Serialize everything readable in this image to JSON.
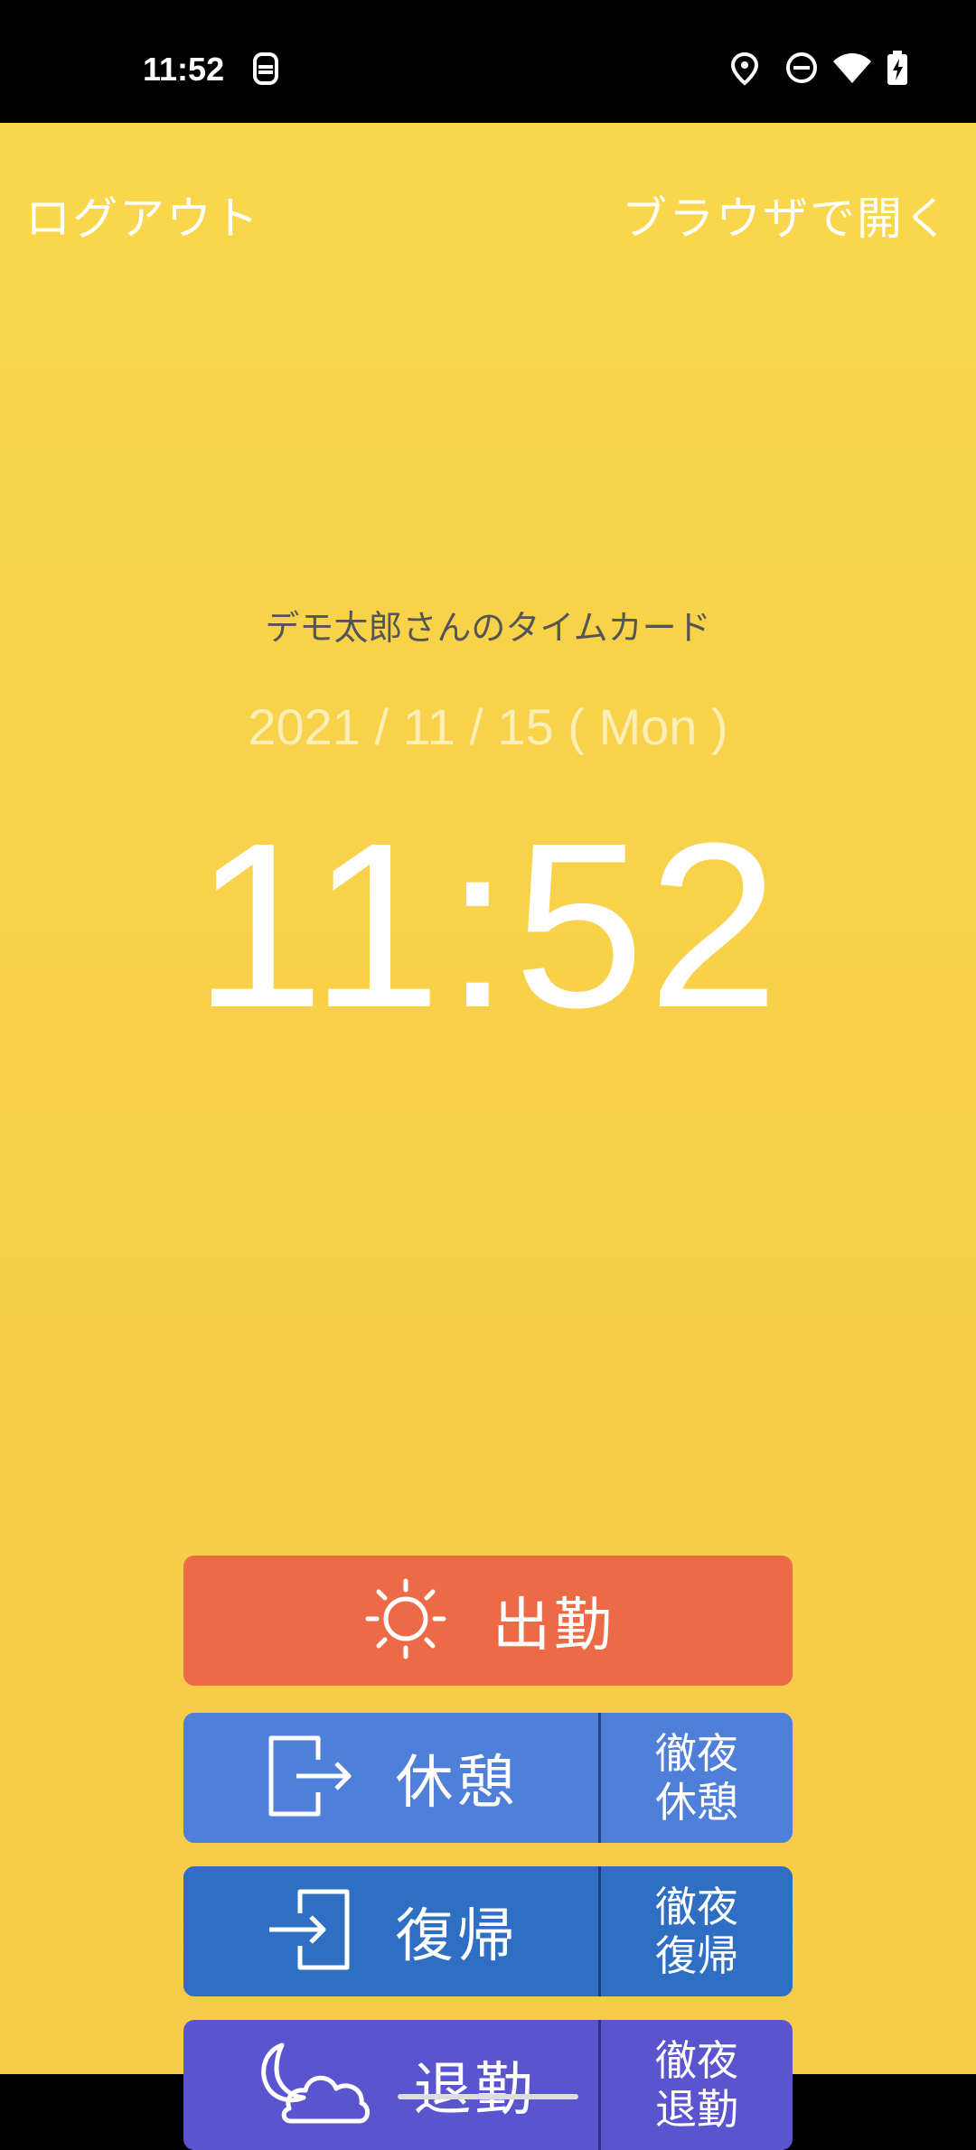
{
  "status_bar": {
    "time": "11:52"
  },
  "topbar": {
    "logout": "ログアウト",
    "open_browser": "ブラウザで開く"
  },
  "timecard": {
    "owner": "デモ太郎さんのタイムカード",
    "date": "2021 / 11 / 15 ( Mon )",
    "time": "11:52"
  },
  "buttons": {
    "clock_in": "出勤",
    "break": {
      "label": "休憩",
      "side_1": "徹夜",
      "side_2": "休憩"
    },
    "return": {
      "label": "復帰",
      "side_1": "徹夜",
      "side_2": "復帰"
    },
    "clock_out": {
      "label": "退勤",
      "side_1": "徹夜",
      "side_2": "退勤"
    }
  }
}
